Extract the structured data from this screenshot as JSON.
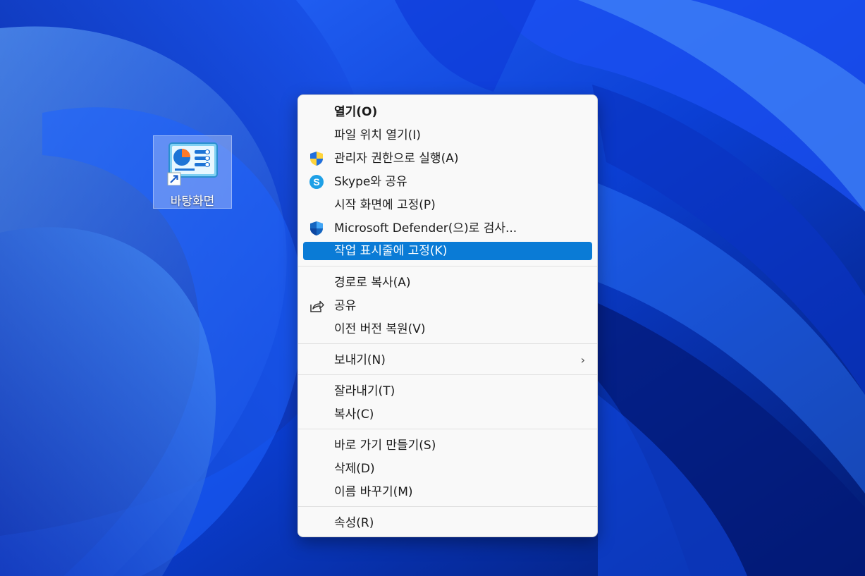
{
  "desktop": {
    "icon_label": "바탕화면",
    "icon_name": "desktop-shortcut-icon"
  },
  "context_menu": {
    "items": [
      {
        "label": "열기(O)",
        "bold": true
      },
      {
        "label": "파일 위치 열기(I)"
      },
      {
        "label": "관리자 권한으로 실행(A)",
        "icon": "uac-shield-icon"
      },
      {
        "label": "Skype와 공유",
        "icon": "skype-icon"
      },
      {
        "label": "시작 화면에 고정(P)"
      },
      {
        "label": "Microsoft Defender(으)로 검사...",
        "icon": "defender-shield-icon"
      },
      {
        "label": "작업 표시줄에 고정(K)",
        "selected": true
      },
      {
        "label": "경로로 복사(A)"
      },
      {
        "label": "공유",
        "icon": "share-icon"
      },
      {
        "label": "이전 버전 복원(V)"
      },
      {
        "label": "보내기(N)",
        "submenu": true
      },
      {
        "label": "잘라내기(T)"
      },
      {
        "label": "복사(C)"
      },
      {
        "label": "바로 가기 만들기(S)"
      },
      {
        "label": "삭제(D)"
      },
      {
        "label": "이름 바꾸기(M)"
      },
      {
        "label": "속성(R)"
      }
    ],
    "submenu_arrow": "›"
  },
  "colors": {
    "menu_background": "#f9f9f9",
    "selection": "#0a7bd6",
    "wallpaper_primary": "#0a3fd0"
  }
}
